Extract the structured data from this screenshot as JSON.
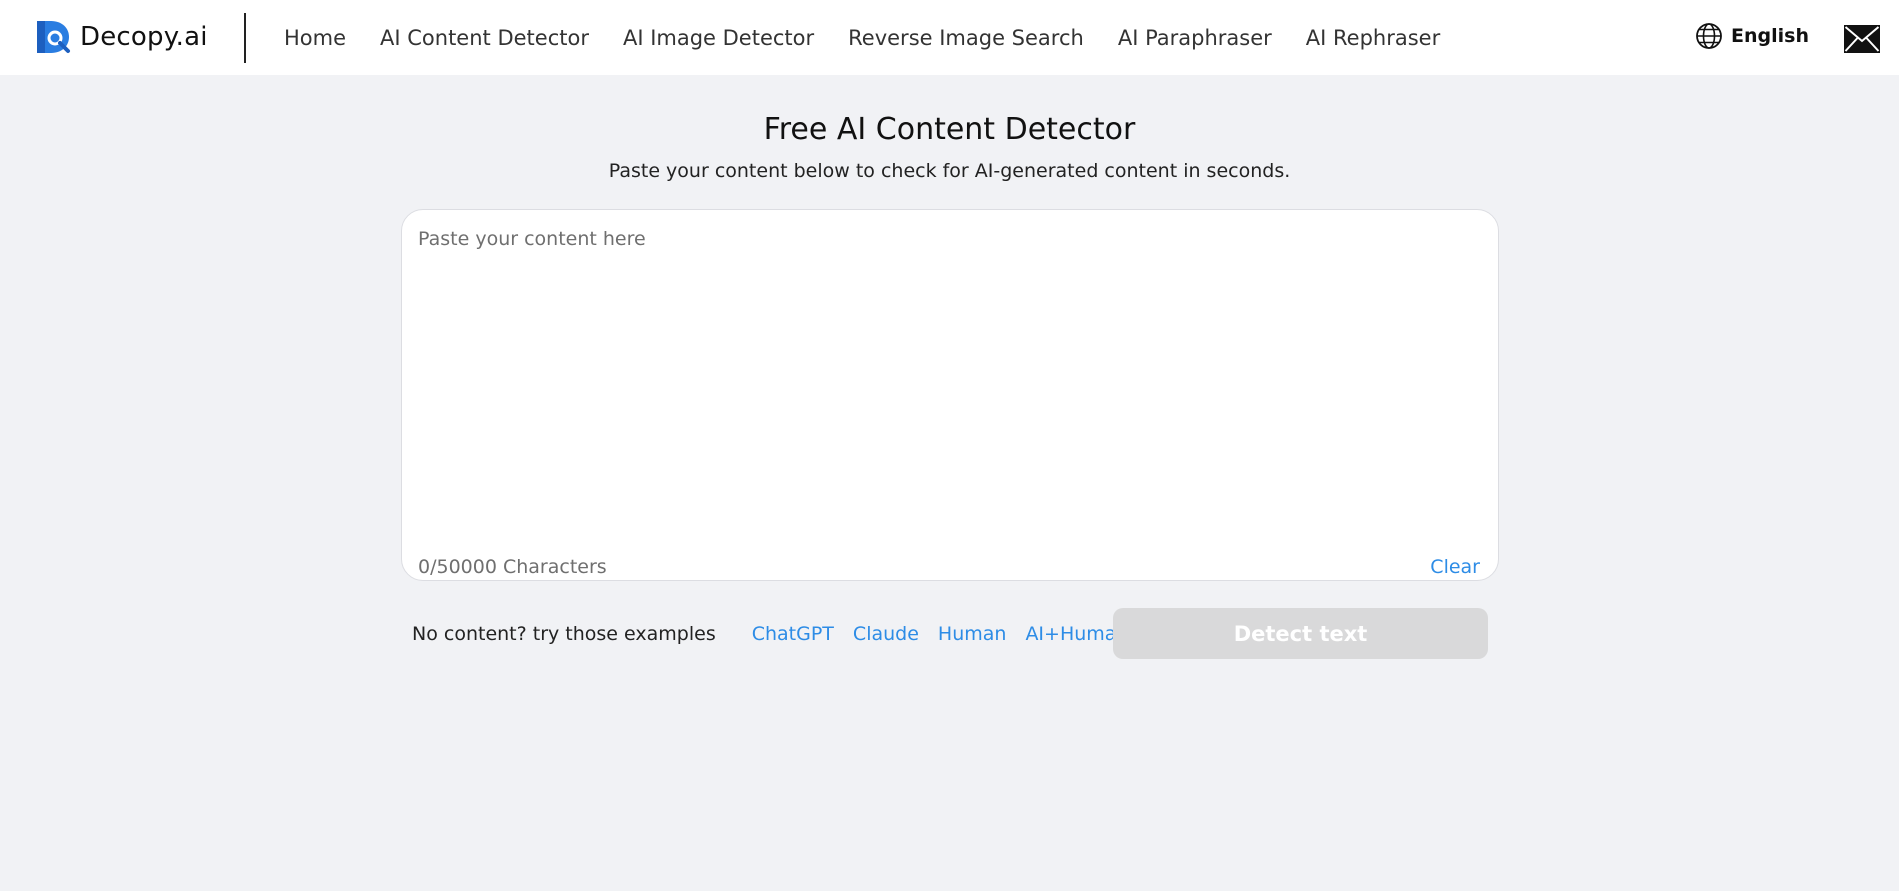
{
  "header": {
    "brand": "Decopy.ai",
    "brand_logo_icon": "decopy-d-magnifier-logo",
    "nav": [
      {
        "label": "Home"
      },
      {
        "label": "AI Content Detector"
      },
      {
        "label": "AI Image Detector"
      },
      {
        "label": "Reverse Image Search"
      },
      {
        "label": "AI Paraphraser"
      },
      {
        "label": "AI Rephraser"
      }
    ],
    "language": "English",
    "language_icon": "globe-icon",
    "mail_icon": "mail-icon"
  },
  "main": {
    "title": "Free AI Content Detector",
    "subtitle": "Paste your content below to check for AI-generated content in seconds.",
    "editor": {
      "placeholder": "Paste your content here",
      "value": "",
      "char_count": "0/50000 Characters",
      "clear_label": "Clear"
    },
    "examples": {
      "label": "No content? try those examples",
      "items": [
        "ChatGPT",
        "Claude",
        "Human",
        "AI+Human"
      ]
    },
    "detect_label": "Detect text"
  },
  "colors": {
    "accent": "#2d8ce6",
    "page_background": "#f1f2f5",
    "button_disabled": "#d9d9da"
  }
}
